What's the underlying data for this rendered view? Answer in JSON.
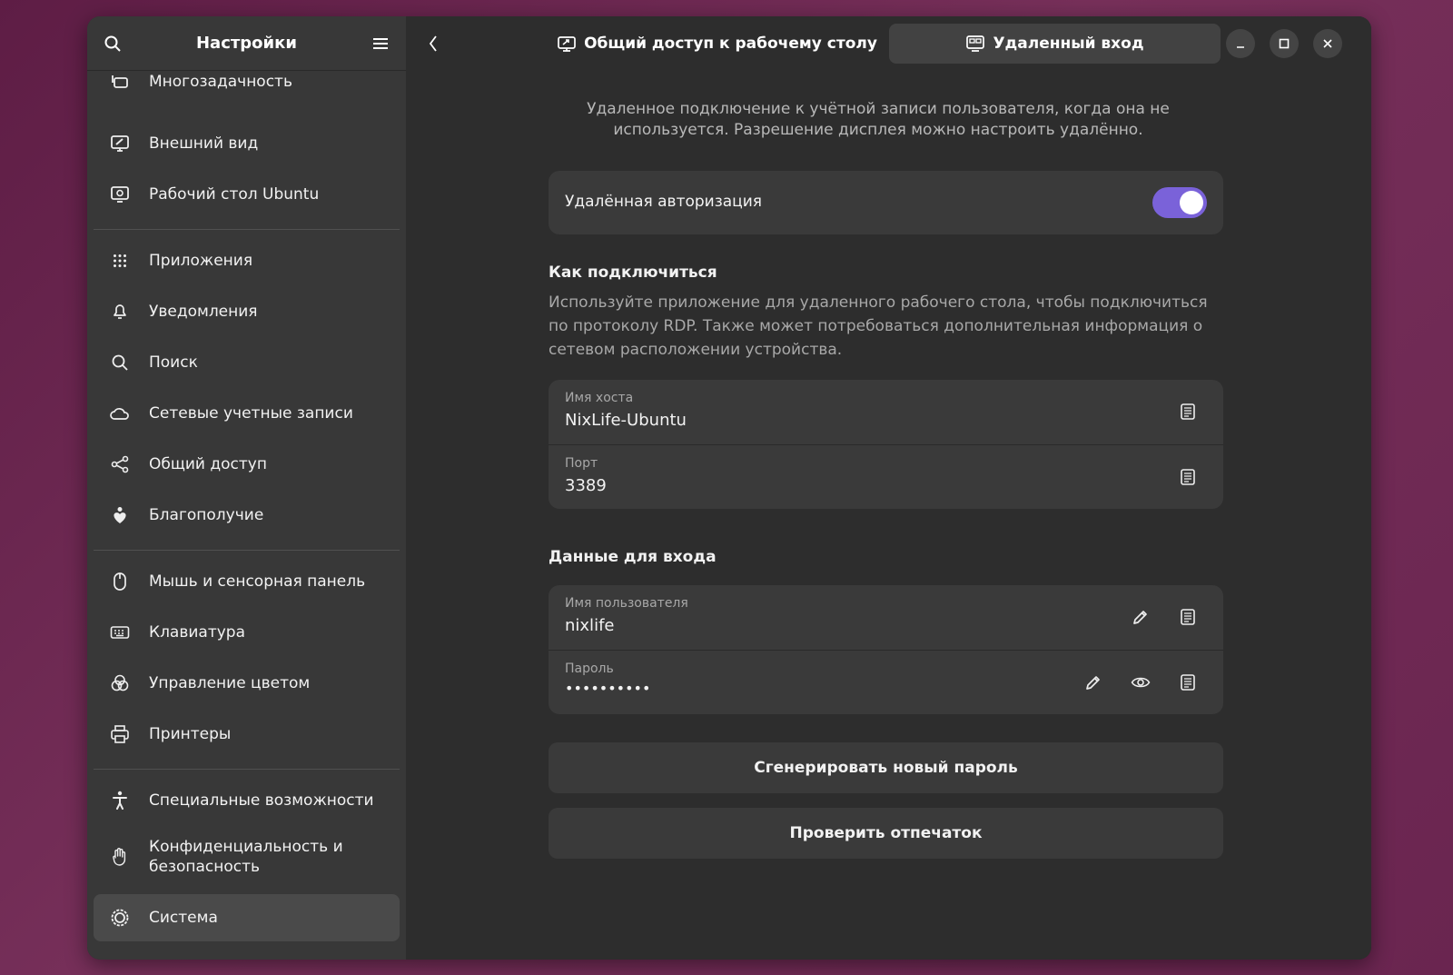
{
  "sidebar": {
    "title": "Настройки",
    "items": [
      {
        "label": "Многозадачность",
        "icon": "multitasking-icon"
      },
      {
        "label": "Внешний вид",
        "icon": "appearance-icon"
      },
      {
        "label": "Рабочий стол Ubuntu",
        "icon": "ubuntu-desktop-icon"
      },
      {
        "label": "Приложения",
        "icon": "apps-grid-icon"
      },
      {
        "label": "Уведомления",
        "icon": "bell-icon"
      },
      {
        "label": "Поиск",
        "icon": "search-icon"
      },
      {
        "label": "Сетевые учетные записи",
        "icon": "cloud-icon"
      },
      {
        "label": "Общий доступ",
        "icon": "share-icon"
      },
      {
        "label": "Благополучие",
        "icon": "wellbeing-icon"
      },
      {
        "label": "Мышь и сенсорная панель",
        "icon": "mouse-icon"
      },
      {
        "label": "Клавиатура",
        "icon": "keyboard-icon"
      },
      {
        "label": "Управление цветом",
        "icon": "color-icon"
      },
      {
        "label": "Принтеры",
        "icon": "printer-icon"
      },
      {
        "label": "Специальные возможности",
        "icon": "accessibility-icon"
      },
      {
        "label": "Конфиденциальность и безопасность",
        "icon": "hand-icon"
      },
      {
        "label": "Система",
        "icon": "system-icon",
        "active": true
      }
    ]
  },
  "tabs": [
    {
      "label": "Общий доступ к рабочему столу",
      "icon": "desktop-share-icon"
    },
    {
      "label": "Удаленный вход",
      "icon": "remote-login-icon",
      "active": true
    }
  ],
  "main": {
    "description": "Удаленное подключение к учётной записи пользователя, когда она не используется. Разрешение дисплея можно настроить удалённо.",
    "remote_auth": {
      "label": "Удалённая авторизация",
      "enabled": true
    },
    "how_to_connect": {
      "title": "Как подключиться",
      "text": "Используйте приложение для удаленного рабочего стола, чтобы подключиться по протоколу RDP. Также может потребоваться дополнительная информация о сетевом расположении устройства.",
      "hostname_label": "Имя хоста",
      "hostname_value": "NixLife-Ubuntu",
      "port_label": "Порт",
      "port_value": "3389"
    },
    "credentials": {
      "title": "Данные для входа",
      "username_label": "Имя пользователя",
      "username_value": "nixlife",
      "password_label": "Пароль",
      "password_value": "••••••••••"
    },
    "generate_button": "Сгенерировать новый пароль",
    "verify_button": "Проверить отпечаток"
  },
  "colors": {
    "accent": "#7a62d9",
    "window_bg": "#2d2d2d",
    "sidebar_bg": "#383838",
    "card_bg": "#3a3a3a"
  }
}
